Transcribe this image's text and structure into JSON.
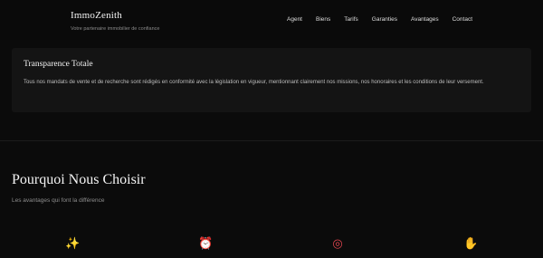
{
  "header": {
    "brand": "ImmoZenith",
    "tagline": "Votre partenaire immobilier de confiance",
    "nav": [
      "Agent",
      "Biens",
      "Tarifs",
      "Garanties",
      "Avantages",
      "Contact"
    ]
  },
  "card": {
    "title": "Transparence Totale",
    "text": "Tous nos mandats de vente et de recherche sont rédigés en conformité avec la législation en vigueur, mentionnant clairement nos missions, nos honoraires et les conditions de leur versement."
  },
  "why": {
    "title": "Pourquoi Nous Choisir",
    "subtitle": "Les avantages qui font la différence",
    "icons": [
      {
        "name": "sparkles-icon",
        "glyph": "✨"
      },
      {
        "name": "alarm-clock-icon",
        "glyph": "⏰"
      },
      {
        "name": "target-icon",
        "glyph": "◎"
      },
      {
        "name": "handshake-icon",
        "glyph": "✋"
      }
    ]
  }
}
